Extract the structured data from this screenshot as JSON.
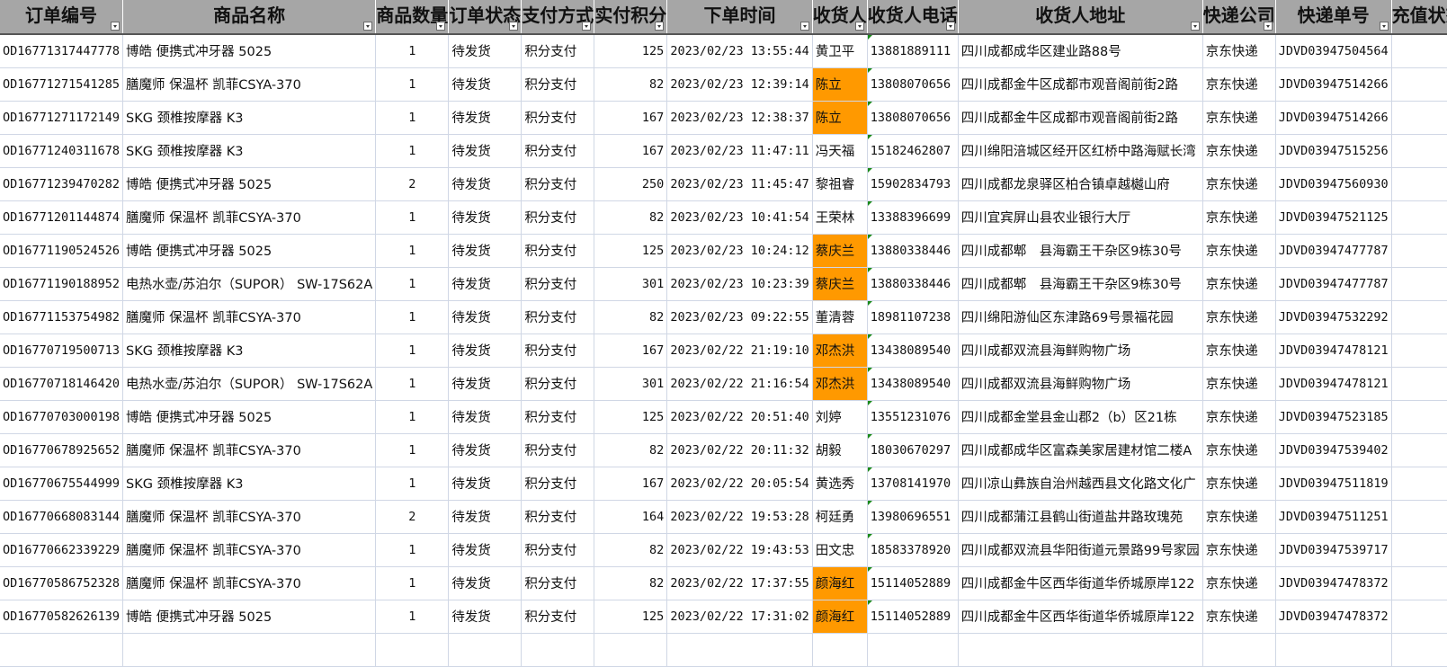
{
  "columns": [
    "订单编号",
    "商品名称",
    "商品数量",
    "订单状态",
    "支付方式",
    "实付积分",
    "下单时间",
    "收货人",
    "收货人电话",
    "收货人地址",
    "快递公司",
    "快递单号",
    "充值状态"
  ],
  "highlight_color": "#ff9900",
  "header_bg": "#a6a6a6",
  "rows": [
    {
      "id": "OD16771317447778",
      "product": "博皓 便携式冲牙器 5025",
      "qty": "1",
      "status": "待发货",
      "pay": "积分支付",
      "points": "125",
      "time": "2023/02/23 13:55:44",
      "name": "黄卫平",
      "phone": "13881889111",
      "addr": "四川成都成华区建业路88号",
      "courier": "京东快递",
      "tracking": "JDVD03947504564",
      "recharge": "",
      "hl": false
    },
    {
      "id": "OD16771271541285",
      "product": "膳魔师 保温杯 凯菲CSYA-370",
      "qty": "1",
      "status": "待发货",
      "pay": "积分支付",
      "points": "82",
      "time": "2023/02/23 12:39:14",
      "name": "陈立",
      "phone": "13808070656",
      "addr": "四川成都金牛区成都市观音阁前街2路",
      "courier": "京东快递",
      "tracking": "JDVD03947514266",
      "recharge": "",
      "hl": true
    },
    {
      "id": "OD16771271172149",
      "product": "SKG 颈椎按摩器 K3",
      "qty": "1",
      "status": "待发货",
      "pay": "积分支付",
      "points": "167",
      "time": "2023/02/23 12:38:37",
      "name": "陈立",
      "phone": "13808070656",
      "addr": "四川成都金牛区成都市观音阁前街2路",
      "courier": "京东快递",
      "tracking": "JDVD03947514266",
      "recharge": "",
      "hl": true
    },
    {
      "id": "OD16771240311678",
      "product": "SKG 颈椎按摩器 K3",
      "qty": "1",
      "status": "待发货",
      "pay": "积分支付",
      "points": "167",
      "time": "2023/02/23 11:47:11",
      "name": "冯天福",
      "phone": "15182462807",
      "addr": "四川绵阳涪城区经开区红桥中路海赋长湾",
      "courier": "京东快递",
      "tracking": "JDVD03947515256",
      "recharge": "",
      "hl": false
    },
    {
      "id": "OD16771239470282",
      "product": "博皓 便携式冲牙器 5025",
      "qty": "2",
      "status": "待发货",
      "pay": "积分支付",
      "points": "250",
      "time": "2023/02/23 11:45:47",
      "name": "黎祖睿",
      "phone": "15902834793",
      "addr": "四川成都龙泉驿区柏合镇卓越樾山府",
      "courier": "京东快递",
      "tracking": "JDVD03947560930",
      "recharge": "",
      "hl": false
    },
    {
      "id": "OD16771201144874",
      "product": "膳魔师 保温杯 凯菲CSYA-370",
      "qty": "1",
      "status": "待发货",
      "pay": "积分支付",
      "points": "82",
      "time": "2023/02/23 10:41:54",
      "name": "王荣林",
      "phone": "13388396699",
      "addr": "四川宜宾屏山县农业银行大厅",
      "courier": "京东快递",
      "tracking": "JDVD03947521125",
      "recharge": "",
      "hl": false
    },
    {
      "id": "OD16771190524526",
      "product": "博皓 便携式冲牙器 5025",
      "qty": "1",
      "status": "待发货",
      "pay": "积分支付",
      "points": "125",
      "time": "2023/02/23 10:24:12",
      "name": "蔡庆兰",
      "phone": "13880338446",
      "addr": "四川成都郫　县海霸王干杂区9栋30号",
      "courier": "京东快递",
      "tracking": "JDVD03947477787",
      "recharge": "",
      "hl": true
    },
    {
      "id": "OD16771190188952",
      "product": "电热水壶/苏泊尔（SUPOR） SW-17S62A",
      "qty": "1",
      "status": "待发货",
      "pay": "积分支付",
      "points": "301",
      "time": "2023/02/23 10:23:39",
      "name": "蔡庆兰",
      "phone": "13880338446",
      "addr": "四川成都郫　县海霸王干杂区9栋30号",
      "courier": "京东快递",
      "tracking": "JDVD03947477787",
      "recharge": "",
      "hl": true
    },
    {
      "id": "OD16771153754982",
      "product": "膳魔师 保温杯 凯菲CSYA-370",
      "qty": "1",
      "status": "待发货",
      "pay": "积分支付",
      "points": "82",
      "time": "2023/02/23 09:22:55",
      "name": "董清蓉",
      "phone": "18981107238",
      "addr": "四川绵阳游仙区东津路69号景福花园",
      "courier": "京东快递",
      "tracking": "JDVD03947532292",
      "recharge": "",
      "hl": false
    },
    {
      "id": "OD16770719500713",
      "product": "SKG 颈椎按摩器 K3",
      "qty": "1",
      "status": "待发货",
      "pay": "积分支付",
      "points": "167",
      "time": "2023/02/22 21:19:10",
      "name": "邓杰洪",
      "phone": "13438089540",
      "addr": "四川成都双流县海鲜购物广场",
      "courier": "京东快递",
      "tracking": "JDVD03947478121",
      "recharge": "",
      "hl": true
    },
    {
      "id": "OD16770718146420",
      "product": "电热水壶/苏泊尔（SUPOR） SW-17S62A",
      "qty": "1",
      "status": "待发货",
      "pay": "积分支付",
      "points": "301",
      "time": "2023/02/22 21:16:54",
      "name": "邓杰洪",
      "phone": "13438089540",
      "addr": "四川成都双流县海鲜购物广场",
      "courier": "京东快递",
      "tracking": "JDVD03947478121",
      "recharge": "",
      "hl": true
    },
    {
      "id": "OD16770703000198",
      "product": "博皓 便携式冲牙器 5025",
      "qty": "1",
      "status": "待发货",
      "pay": "积分支付",
      "points": "125",
      "time": "2023/02/22 20:51:40",
      "name": "刘婷",
      "phone": "13551231076",
      "addr": "四川成都金堂县金山郡2（b）区21栋",
      "courier": "京东快递",
      "tracking": "JDVD03947523185",
      "recharge": "",
      "hl": false
    },
    {
      "id": "OD16770678925652",
      "product": "膳魔师 保温杯 凯菲CSYA-370",
      "qty": "1",
      "status": "待发货",
      "pay": "积分支付",
      "points": "82",
      "time": "2023/02/22 20:11:32",
      "name": "胡毅",
      "phone": "18030670297",
      "addr": "四川成都成华区富森美家居建材馆二楼A",
      "courier": "京东快递",
      "tracking": "JDVD03947539402",
      "recharge": "",
      "hl": false
    },
    {
      "id": "OD16770675544999",
      "product": "SKG 颈椎按摩器 K3",
      "qty": "1",
      "status": "待发货",
      "pay": "积分支付",
      "points": "167",
      "time": "2023/02/22 20:05:54",
      "name": "黄选秀",
      "phone": "13708141970",
      "addr": "四川凉山彝族自治州越西县文化路文化广",
      "courier": "京东快递",
      "tracking": "JDVD03947511819",
      "recharge": "",
      "hl": false
    },
    {
      "id": "OD16770668083144",
      "product": "膳魔师 保温杯 凯菲CSYA-370",
      "qty": "2",
      "status": "待发货",
      "pay": "积分支付",
      "points": "164",
      "time": "2023/02/22 19:53:28",
      "name": "柯廷勇",
      "phone": "13980696551",
      "addr": "四川成都蒲江县鹤山街道盐井路玫瑰苑",
      "courier": "京东快递",
      "tracking": "JDVD03947511251",
      "recharge": "",
      "hl": false
    },
    {
      "id": "OD16770662339229",
      "product": "膳魔师 保温杯 凯菲CSYA-370",
      "qty": "1",
      "status": "待发货",
      "pay": "积分支付",
      "points": "82",
      "time": "2023/02/22 19:43:53",
      "name": "田文忠",
      "phone": "18583378920",
      "addr": "四川成都双流县华阳街道元景路99号家园",
      "courier": "京东快递",
      "tracking": "JDVD03947539717",
      "recharge": "",
      "hl": false
    },
    {
      "id": "OD16770586752328",
      "product": "膳魔师 保温杯 凯菲CSYA-370",
      "qty": "1",
      "status": "待发货",
      "pay": "积分支付",
      "points": "82",
      "time": "2023/02/22 17:37:55",
      "name": "颜海红",
      "phone": "15114052889",
      "addr": "四川成都金牛区西华街道华侨城原岸122",
      "courier": "京东快递",
      "tracking": "JDVD03947478372",
      "recharge": "",
      "hl": true
    },
    {
      "id": "OD16770582626139",
      "product": "博皓 便携式冲牙器 5025",
      "qty": "1",
      "status": "待发货",
      "pay": "积分支付",
      "points": "125",
      "time": "2023/02/22 17:31:02",
      "name": "颜海红",
      "phone": "15114052889",
      "addr": "四川成都金牛区西华街道华侨城原岸122",
      "courier": "京东快递",
      "tracking": "JDVD03947478372",
      "recharge": "",
      "hl": true
    }
  ]
}
